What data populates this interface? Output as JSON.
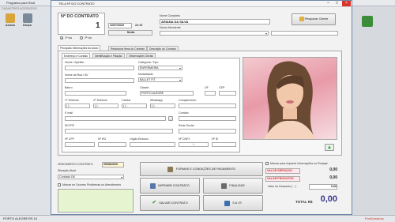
{
  "app": {
    "title": "Programa para Stud",
    "toolbar_hint": "CADASTROS ACESSORIO",
    "nav": [
      {
        "label": "Alunos",
        "icon": "students-icon",
        "color": "#d9a43a"
      },
      {
        "label": "Dança",
        "icon": "dance-icon",
        "color": "#7a8a9a"
      }
    ],
    "status": {
      "city": "PORTO ALEGRE",
      "extra": "RS 10",
      "right_label": "PosSumários"
    }
  },
  "dialog": {
    "title": "TELA Nº DO CONTRATO",
    "contract_label": "Nº DO CONTRATO",
    "contract_number": "1",
    "date": "10/07/2020",
    "time": "22:15",
    "weekday": "Sexta",
    "period_options": [
      "1ª via",
      "2ª via"
    ],
    "name_label": "Nome Completo",
    "name_value": "ARIANA DA SILVA",
    "search_client_label": "Pesquisar Cliente",
    "attendant_label": "Nome Atendente",
    "tabs": [
      "Principais Informações do Aluno",
      "Relacionar Itens do Contrato",
      "Descrição do Contrato"
    ],
    "subtabs": [
      "Endereço e Contato",
      "Identificação e Filiação",
      "Observações Gerais"
    ],
    "fields": {
      "nickname_label": "Nome / Apelido",
      "street_label": "Nome da Rua / AV",
      "category_label": "Categoria / Tipo",
      "category_value": "ENFERMEIRA",
      "modality_label": "Modalidade",
      "modality_value": "BALLET FIT",
      "district_label": "Bairro",
      "city_label": "Cidade",
      "city_value": "PORTO ALEGRE",
      "uf_label": "UF",
      "cep_label": "CEP",
      "phone1_label": "1º Telefone",
      "phone2_label": "2º Telefone",
      "cell_label": "Celular",
      "whatsapp_label": "Whatsapp",
      "complement_label": "Complemento",
      "phone_mask": "(  )  -",
      "email_label": "E mail",
      "contact_label": "Contato",
      "skype_label": "SKYPE",
      "social_label": "Rede Social",
      "cpf_label": "Nº CPF",
      "rg_label": "Nº RG",
      "issuer_label": "Orgão Emissor",
      "cnpj_label": "Nº CNPJ",
      "ie_label": "Nº IE",
      "cpf_mask": ".  .  -",
      "cnpj_mask": "/  -"
    },
    "expiry_label": "VENCIMENTO CONTRATO",
    "expiry_value": "09/08/2020",
    "situation_label": "Situação Atual",
    "situation_value": "Contrato OK",
    "problem_checkbox": "Marcar se Ocorreu Problemas no Atendimento",
    "buttons": {
      "payment": "FORMAS E CONDIÇÕES DE PAGAMENTO",
      "print": "IMPRIMIR CONTRATO",
      "finish": "FINALIZAR",
      "save": "SALVAR CONTRATO",
      "exit": "S A I R"
    },
    "print_footer_checkbox": "Marcar para Imprimir Informações no Rodapé",
    "totals": {
      "services_label": "VALOR SERVIÇOS",
      "services_value": "0,00",
      "products_label": "VALOR PRODUTOS",
      "products_value": "0,00",
      "discount_label": "Valor do Desconto ( - )",
      "discount_value": "0,00",
      "total_label": "TOTAL R$",
      "total_value": "0,00"
    },
    "colors": {
      "accent_red": "#c0392b",
      "note_green": "#e6f5d0",
      "pink_field": "#ffe8ee"
    }
  }
}
